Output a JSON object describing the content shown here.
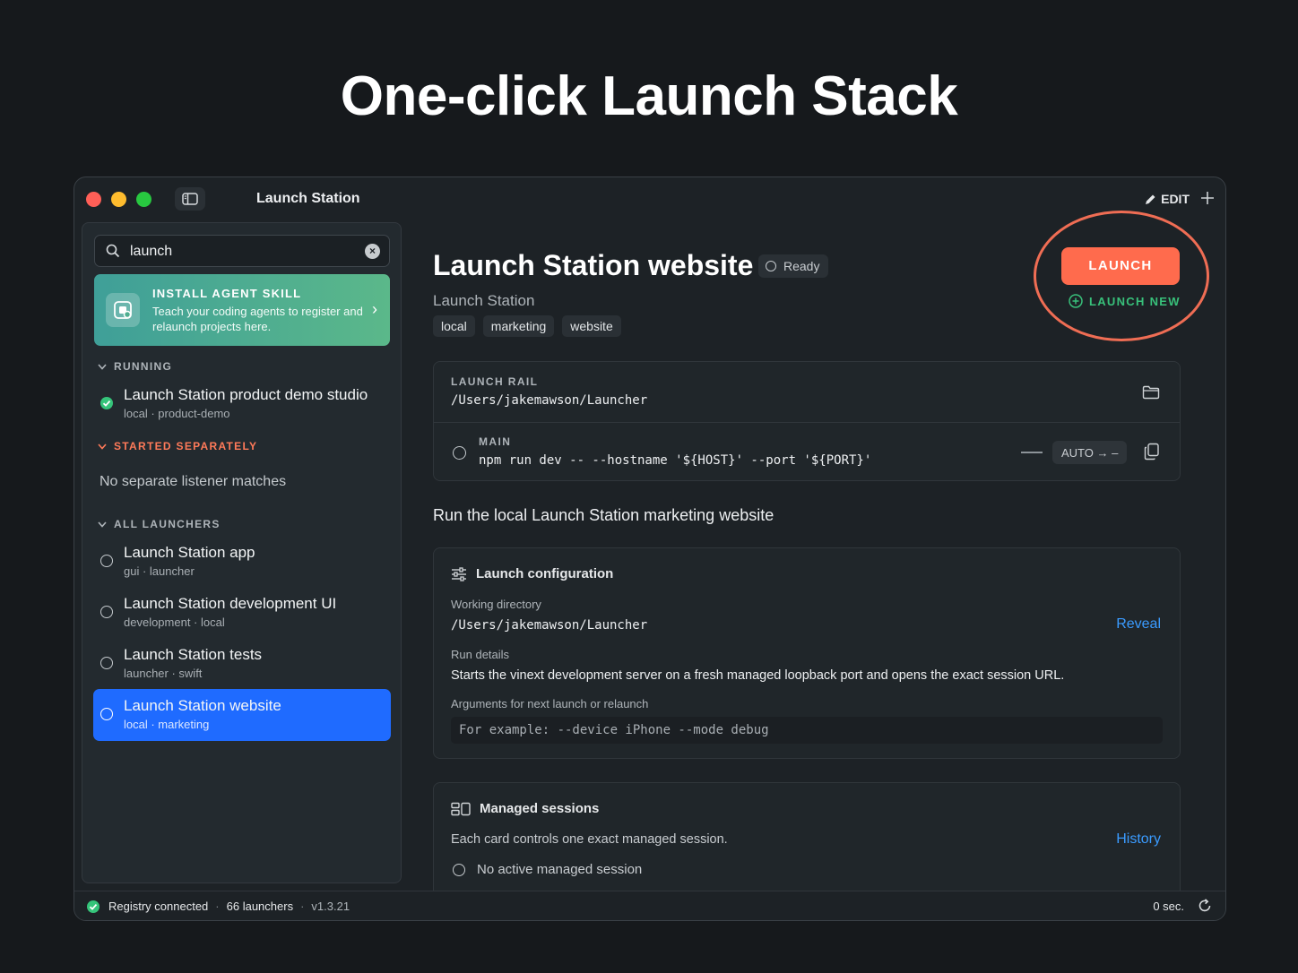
{
  "headline": "One-click Launch Stack",
  "window": {
    "title": "Launch Station",
    "edit_label": "EDIT",
    "add_label": "+"
  },
  "sidebar": {
    "search": {
      "value": "launch",
      "placeholder": ""
    },
    "skill_card": {
      "title": "INSTALL AGENT SKILL",
      "description": "Teach your coding agents to register and relaunch projects here."
    },
    "sections": {
      "running": "RUNNING",
      "started_separately": "STARTED SEPARATELY",
      "all_launchers": "ALL LAUNCHERS"
    },
    "running_items": [
      {
        "title": "Launch Station product demo studio",
        "sub": "local · product-demo",
        "status": "running"
      }
    ],
    "separate_empty": "No separate listener matches",
    "launchers": [
      {
        "title": "Launch Station app",
        "sub": "gui · launcher",
        "selected": false
      },
      {
        "title": "Launch Station development UI",
        "sub": "development · local",
        "selected": false
      },
      {
        "title": "Launch Station tests",
        "sub": "launcher · swift",
        "selected": false
      },
      {
        "title": "Launch Station website",
        "sub": "local · marketing",
        "selected": true
      }
    ]
  },
  "detail": {
    "title": "Launch Station website",
    "status": "Ready",
    "subtitle": "Launch Station",
    "tags": [
      "local",
      "marketing",
      "website"
    ],
    "launch_label": "LAUNCH",
    "launch_new_label": "LAUNCH NEW",
    "rail": {
      "label": "LAUNCH RAIL",
      "path": "/Users/jakemawson/Launcher",
      "main_label": "MAIN",
      "command": "npm run dev -- --hostname '${HOST}' --port '${PORT}'",
      "auto_label": "AUTO → –"
    },
    "description": "Run the local Launch Station marketing website",
    "config": {
      "heading": "Launch configuration",
      "working_dir_label": "Working directory",
      "working_dir": "/Users/jakemawson/Launcher",
      "reveal_label": "Reveal",
      "run_details_label": "Run details",
      "run_details": "Starts the vinext development server on a fresh managed loopback port and opens the exact session URL.",
      "args_label": "Arguments for next launch or relaunch",
      "args_placeholder": "For example: --device iPhone --mode debug"
    },
    "sessions": {
      "heading": "Managed sessions",
      "description": "Each card controls one exact managed session.",
      "history_label": "History",
      "empty": "No active managed session"
    }
  },
  "statusbar": {
    "registry": "Registry connected",
    "launchers": "66 launchers",
    "version": "v1.3.21",
    "elapsed": "0 sec."
  },
  "colors": {
    "accent": "#ff6b4d",
    "selection": "#1f6bff",
    "success": "#35c47a",
    "link": "#3a9bff",
    "warning": "#ff7a59"
  }
}
